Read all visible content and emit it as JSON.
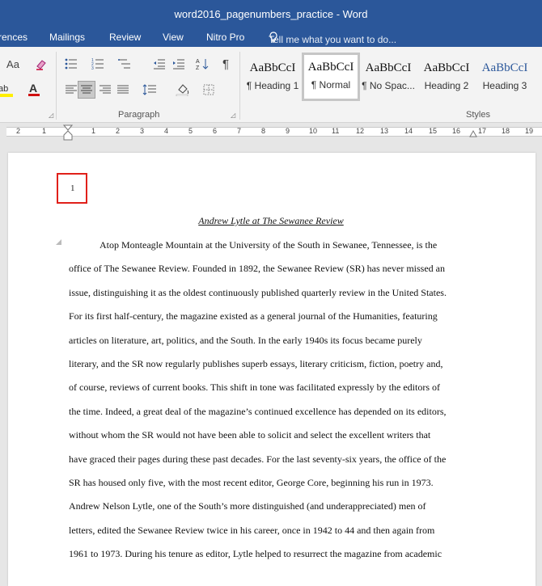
{
  "window": {
    "title": "word2016_pagenumbers_practice - Word"
  },
  "tabs": [
    {
      "id": "references",
      "label": "rences"
    },
    {
      "id": "mailings",
      "label": "Mailings"
    },
    {
      "id": "review",
      "label": "Review"
    },
    {
      "id": "view",
      "label": "View"
    },
    {
      "id": "nitro",
      "label": "Nitro Pro"
    }
  ],
  "tellme": {
    "text": "Tell me what you want to do..."
  },
  "ribbon": {
    "font_group_partial": {
      "case_label": "Aa"
    },
    "paragraph_group": {
      "label": "Paragraph"
    },
    "styles_group": {
      "label": "Styles"
    }
  },
  "styles": [
    {
      "sample": "AaBbCcI",
      "name": "¶ Heading 1",
      "selected": false
    },
    {
      "sample": "AaBbCcI",
      "name": "¶ Normal",
      "selected": true
    },
    {
      "sample": "AaBbCcI",
      "name": "¶ No Spac...",
      "selected": false
    },
    {
      "sample": "AaBbCcI",
      "name": "Heading 2",
      "selected": false
    },
    {
      "sample": "AaBbCcI",
      "name": "Heading 3",
      "selected": false,
      "color": "#2b579a"
    }
  ],
  "ruler": {
    "numbers": [
      "2",
      "1",
      "1",
      "1",
      "2",
      "3",
      "4",
      "5",
      "6",
      "7",
      "8",
      "9",
      "10",
      "11",
      "12",
      "13",
      "14",
      "15",
      "16",
      "17",
      "18",
      "19"
    ]
  },
  "document": {
    "page_number": "1",
    "title": "Andrew Lytle at The Sewanee Review",
    "lines": [
      "Atop Monteagle Mountain at the University of the South in Sewanee, Tennessee, is the",
      "office of The Sewanee Review. Founded in 1892, the Sewanee Review (SR) has never missed an",
      "issue, distinguishing it as the oldest continuously published quarterly review in the United States.",
      "For its first half-century, the magazine existed as a general journal of the Humanities, featuring",
      "articles on literature, art, politics, and the South. In the early 1940s its focus became purely",
      "literary, and the SR now regularly publishes superb essays, literary criticism, fiction, poetry and,",
      "of course, reviews of current books. This shift in tone was facilitated expressly by the editors of",
      "the time. Indeed, a great deal of the magazine’s continued excellence has depended on its editors,",
      "without whom the SR would not have been able to solicit and select the excellent writers that",
      "have graced their pages during these past decades. For the last seventy-six years, the office of the",
      "SR has housed only five, with the most recent editor, George Core, beginning his run in 1973.",
      "Andrew Nelson Lytle, one of the South’s more distinguished (and underappreciated) men of",
      "letters, edited the Sewanee Review twice in his career, once in 1942 to 44 and then again from",
      "1961 to 1973. During his tenure as editor, Lytle helped to resurrect the magazine from academic"
    ]
  }
}
